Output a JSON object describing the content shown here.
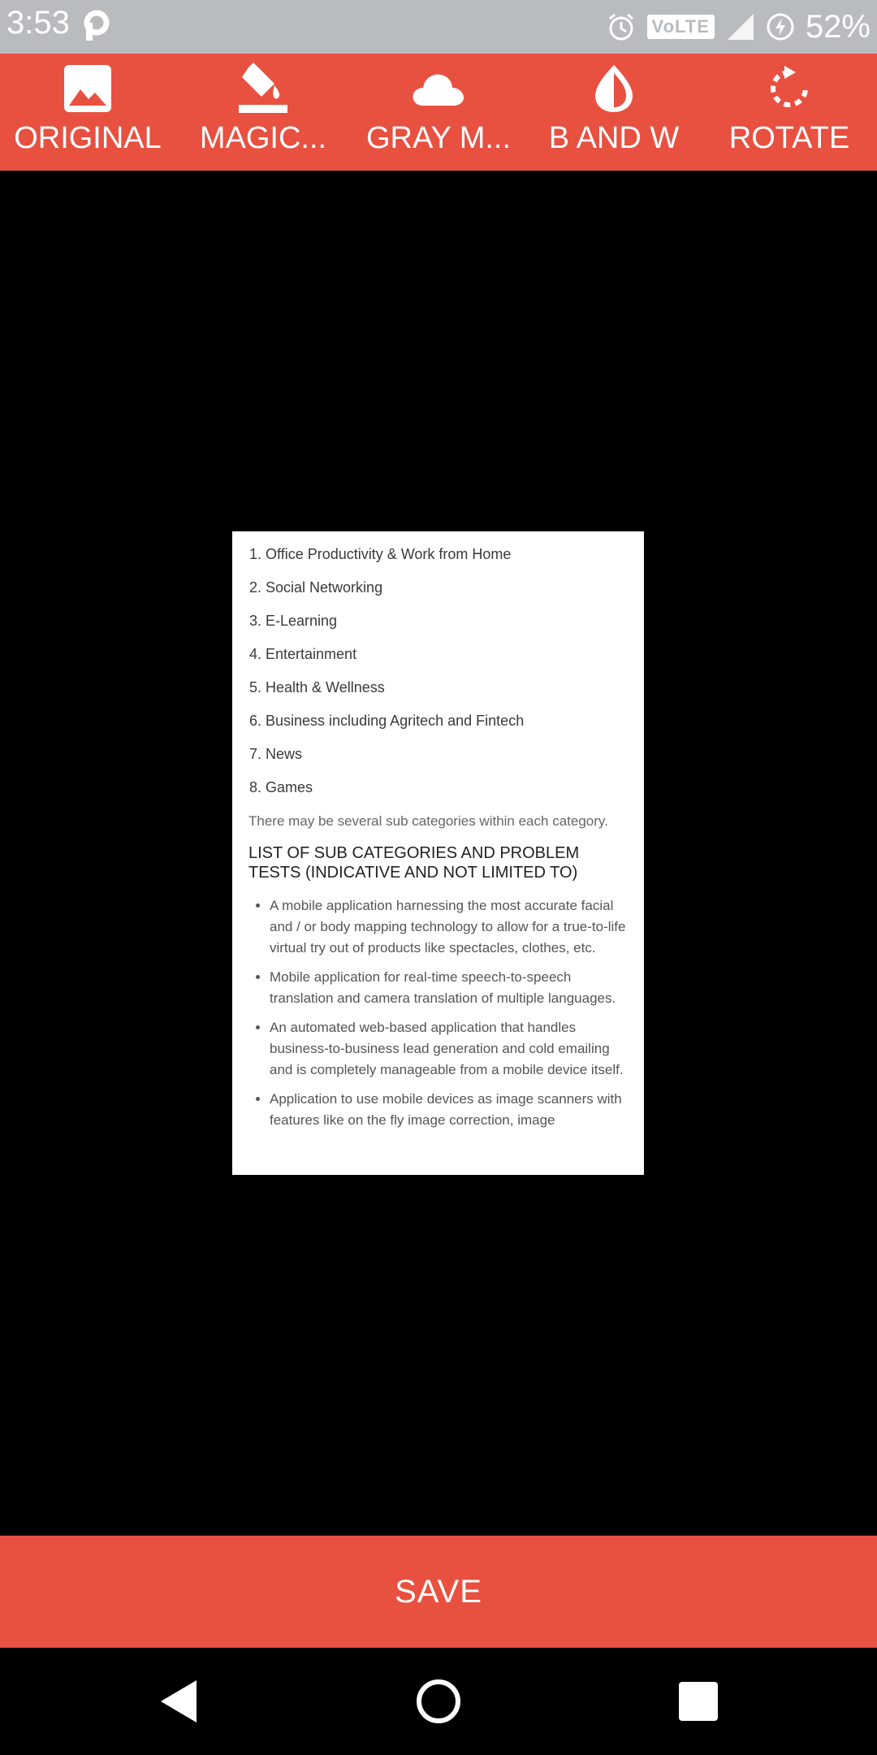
{
  "status_bar": {
    "time": "3:53",
    "network": "VoLTE",
    "battery": "52%",
    "icons": [
      "p-app-icon",
      "alarm-icon",
      "volte-icon",
      "signal-icon",
      "battery-icon"
    ]
  },
  "toolbar": {
    "items": [
      {
        "label": "ORIGINAL",
        "icon": "image-icon"
      },
      {
        "label": "MAGIC...",
        "icon": "paint-bucket-icon"
      },
      {
        "label": "GRAY M...",
        "icon": "cloud-icon"
      },
      {
        "label": "B AND W",
        "icon": "drop-icon"
      },
      {
        "label": "ROTATE",
        "icon": "rotate-icon"
      }
    ]
  },
  "document": {
    "categories": [
      "1. Office Productivity & Work from Home",
      "2. Social Networking",
      "3. E-Learning",
      "4. Entertainment",
      "5. Health & Wellness",
      "6. Business including Agritech and Fintech",
      "7. News",
      "8. Games"
    ],
    "note": "There may be several sub categories within each category.",
    "heading": "LIST OF SUB CATEGORIES AND PROBLEM TESTS (INDICATIVE AND NOT LIMITED TO)",
    "bullets": [
      "A mobile application harnessing the most accurate facial and / or body mapping technology to allow for a true-to-life virtual try out of products like spectacles, clothes, etc.",
      "Mobile application for real-time speech-to-speech translation and camera translation of multiple languages.",
      "An automated web-based application that handles business-to-business lead generation and cold emailing and is completely manageable from a mobile device itself.",
      "Application to use mobile devices as image scanners with features like on the fly image correction, image"
    ]
  },
  "actions": {
    "save_label": "SAVE"
  },
  "colors": {
    "accent": "#e85040",
    "status_bar": "#b9bcbf",
    "background": "#000000"
  }
}
